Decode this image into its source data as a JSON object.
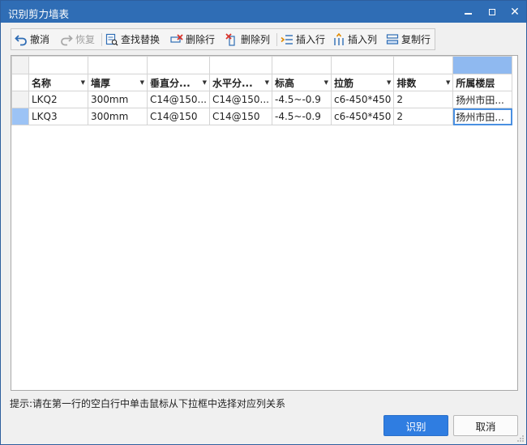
{
  "window": {
    "title": "识别剪力墙表",
    "controls": {
      "minimize": "minimize",
      "maximize": "maximize",
      "close": "✕"
    }
  },
  "toolbar": {
    "undo": "撤消",
    "redo": "恢复",
    "find_replace": "查找替换",
    "delete_row": "删除行",
    "delete_col": "删除列",
    "insert_row": "插入行",
    "insert_col": "插入列",
    "copy_row": "复制行"
  },
  "grid": {
    "columns": [
      "名称",
      "墙厚",
      "垂直分...",
      "水平分...",
      "标高",
      "拉筋",
      "排数",
      "所属楼层"
    ],
    "rows": [
      [
        "LKQ2",
        "300mm",
        "C14@150...",
        "C14@150...",
        "-4.5~-0.9",
        "c6-450*450",
        "2",
        "扬州市田..."
      ],
      [
        "LKQ3",
        "300mm",
        "C14@150",
        "C14@150",
        "-4.5~-0.9",
        "c6-450*450",
        "2",
        "扬州市田..."
      ]
    ]
  },
  "hint": "提示:请在第一行的空白行中单击鼠标从下拉框中选择对应列关系",
  "buttons": {
    "ok": "识别",
    "cancel": "取消"
  },
  "colors": {
    "titlebar": "#2f6db5",
    "accent": "#2f7de1",
    "selection": "#8fb9f0"
  }
}
